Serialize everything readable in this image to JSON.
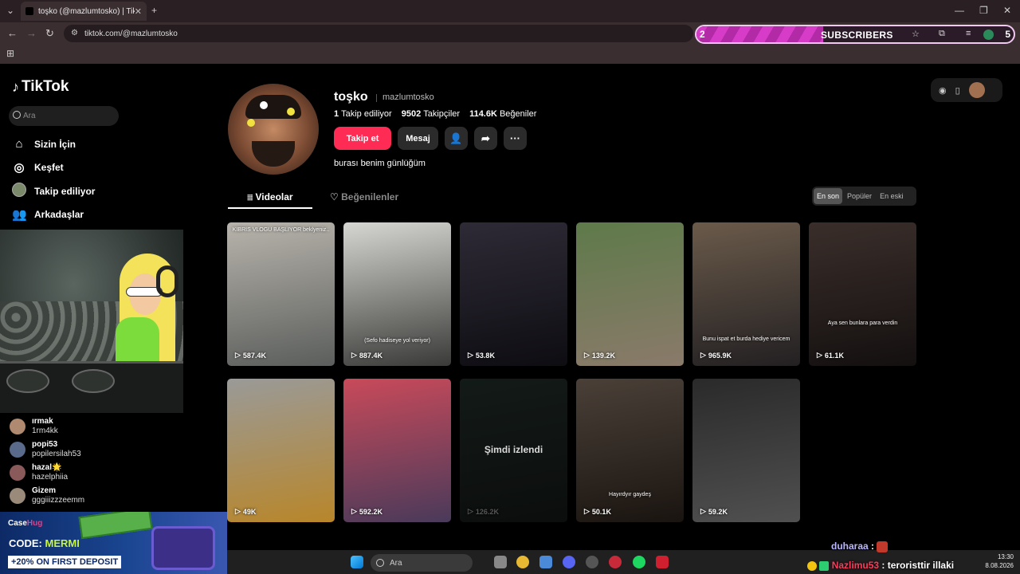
{
  "browser": {
    "tab_title": "toşko (@mazlumtosko) | TikTok",
    "url": "tiktok.com/@mazlumtosko"
  },
  "subscriber_goal": {
    "current": "2",
    "label": "SUBSCRIBERS",
    "target": "5",
    "progress_fraction": 0.4,
    "fill_color": "#d63cc8"
  },
  "sidebar": {
    "logo": "TikTok",
    "search_placeholder": "Ara",
    "nav": [
      {
        "label": "Sizin İçin",
        "icon": "home-icon"
      },
      {
        "label": "Keşfet",
        "icon": "compass-icon"
      },
      {
        "label": "Takip ediliyor",
        "icon": "avatar-icon"
      },
      {
        "label": "Arkadaşlar",
        "icon": "friends-icon"
      }
    ],
    "following": [
      {
        "name": "ırmak",
        "handle": "1rm4kk"
      },
      {
        "name": "popi53",
        "handle": "popilersilah53"
      },
      {
        "name": "hazal🌟",
        "handle": "hazelphiia"
      },
      {
        "name": "Gizem",
        "handle": "gggiiizzzeemm"
      }
    ]
  },
  "ad": {
    "brand_prefix": "Case",
    "brand_suffix": "Hug",
    "code_label": "CODE:",
    "code_value": "MERMI",
    "deposit": "+20% ON FIRST DEPOSIT"
  },
  "profile": {
    "name": "toşko",
    "username": "mazlumtosko",
    "following_count": "1",
    "following_label": "Takip ediliyor",
    "followers_count": "9502",
    "followers_label": "Takipçiler",
    "likes_count": "114.6K",
    "likes_label": "Beğeniler",
    "follow_btn": "Takip et",
    "message_btn": "Mesaj",
    "bio": "burası benim günlüğüm",
    "accent_color": "#fe2c55"
  },
  "tabs": {
    "videos": "Videolar",
    "liked": "Beğenilenler",
    "sort": [
      "En son",
      "Popüler",
      "En eski"
    ],
    "sort_active": "En son"
  },
  "videos": [
    {
      "views": "587.4K",
      "caption": "KIBRIS VLOGU BAŞLIYOR beklyeniz..",
      "colors": [
        "#b8b4ac",
        "#5b5e5c"
      ]
    },
    {
      "views": "887.4K",
      "caption": "(Sefo hadiseye yol veriyor)",
      "colors": [
        "#d6d6d2",
        "#3a3a38"
      ]
    },
    {
      "views": "53.8K",
      "caption": "",
      "colors": [
        "#2e2a36",
        "#0e0d12"
      ]
    },
    {
      "views": "139.2K",
      "caption": "",
      "colors": [
        "#5e7a4a",
        "#8a7a6a"
      ]
    },
    {
      "views": "965.9K",
      "caption": "Bunu ispat et burda hediye vericem",
      "colors": [
        "#6a5a4a",
        "#232022"
      ]
    },
    {
      "views": "61.1K",
      "caption": "Aya sen bunlara para verdin",
      "colors": [
        "#3a2e2a",
        "#141010"
      ]
    },
    {
      "views": "49K",
      "caption": "",
      "colors": [
        "#9a9a98",
        "#b8862a"
      ]
    },
    {
      "views": "592.2K",
      "caption": "",
      "colors": [
        "#c84a5a",
        "#4a3a5a"
      ]
    },
    {
      "views": "126.2K",
      "caption": "",
      "colors": [
        "#2a3a34",
        "#1a1e1c"
      ],
      "watched": "Şimdi izlendi"
    },
    {
      "views": "50.1K",
      "caption": "Hayırdyır gaydeş",
      "colors": [
        "#4a4038",
        "#1a1410"
      ]
    },
    {
      "views": "59.2K",
      "caption": "",
      "colors": [
        "#2a2a2a",
        "#505050"
      ]
    }
  ],
  "taskbar": {
    "search": "Ara",
    "time": "13:30",
    "date": "8.08.2026"
  },
  "chat": [
    {
      "user": "duharaa",
      "text": ":"
    },
    {
      "user": "Nazlimu53",
      "text": ": teroristtir illaki"
    }
  ]
}
